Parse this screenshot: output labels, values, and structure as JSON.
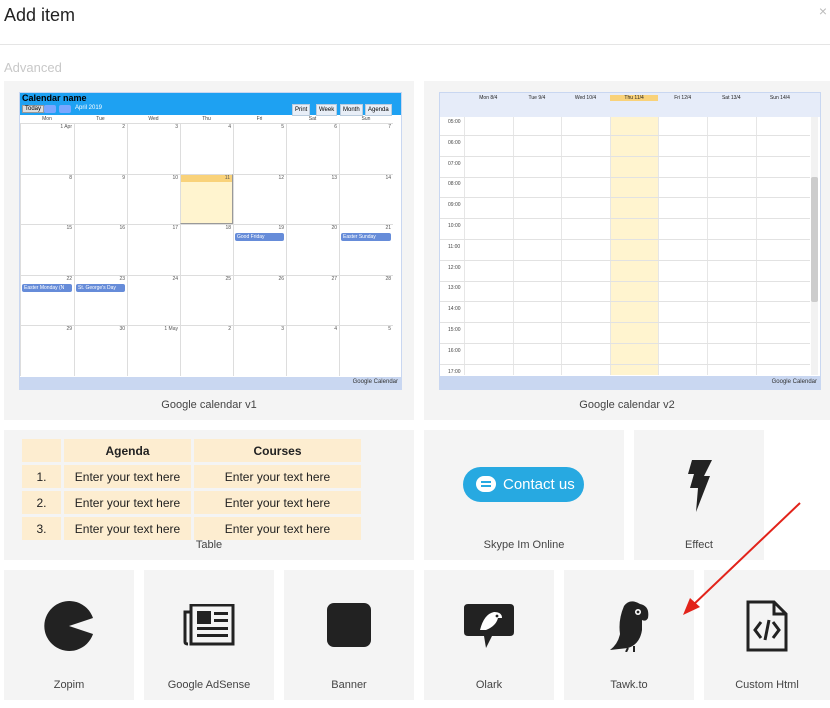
{
  "dialog": {
    "title": "Add item",
    "close_label": "×",
    "section_label": "Advanced"
  },
  "cards": {
    "gcal1": "Google calendar v1",
    "gcal2": "Google calendar v2",
    "table": "Table",
    "skype": "Skype Im Online",
    "effect": "Effect",
    "zopim": "Zopim",
    "adsense": "Google AdSense",
    "banner": "Banner",
    "olark": "Olark",
    "tawk": "Tawk.to",
    "custom": "Custom Html"
  },
  "cal1": {
    "name": "Calendar name",
    "today": "Today",
    "month": "April 2019",
    "print": "Print",
    "views": [
      "Week",
      "Month",
      "Agenda"
    ],
    "weekdays": [
      "Mon",
      "Tue",
      "Wed",
      "Thu",
      "Fri",
      "Sat",
      "Sun"
    ],
    "weeks": [
      [
        "1 Apr",
        "2",
        "3",
        "4",
        "5",
        "6",
        "7"
      ],
      [
        "8",
        "9",
        "10",
        "11",
        "12",
        "13",
        "14"
      ],
      [
        "15",
        "16",
        "17",
        "18",
        "19",
        "20",
        "21"
      ],
      [
        "22",
        "23",
        "24",
        "25",
        "26",
        "27",
        "28"
      ],
      [
        "29",
        "30",
        "1 May",
        "2",
        "3",
        "4",
        "5"
      ]
    ],
    "events": [
      "Good Friday",
      "Easter Sunday",
      "Easter Monday (N",
      "St. George's Day"
    ],
    "footer": "Google Calendar"
  },
  "cal2": {
    "days": [
      "Mon 8/4",
      "Tue 9/4",
      "Wed 10/4",
      "Thu 11/4",
      "Fri 12/4",
      "Sat 13/4",
      "Sun 14/4"
    ],
    "times": [
      "05:00",
      "06:00",
      "07:00",
      "08:00",
      "09:00",
      "10:00",
      "11:00",
      "12:00",
      "13:00",
      "14:00",
      "15:00",
      "16:00",
      "17:00"
    ],
    "footer": "Google Calendar"
  },
  "table_preview": {
    "headers": [
      "",
      "Agenda",
      "Courses"
    ],
    "rows": [
      [
        "1.",
        "Enter your text here",
        "Enter your text here"
      ],
      [
        "2.",
        "Enter your text here",
        "Enter your text here"
      ],
      [
        "3.",
        "Enter your text here",
        "Enter your text here"
      ]
    ]
  },
  "skype_button": "Contact us",
  "icons": [
    "lightning-icon",
    "pacman-icon",
    "newspaper-icon",
    "square-icon",
    "olark-bird-icon",
    "parrot-icon",
    "html-file-icon",
    "red-arrow-annotation"
  ]
}
